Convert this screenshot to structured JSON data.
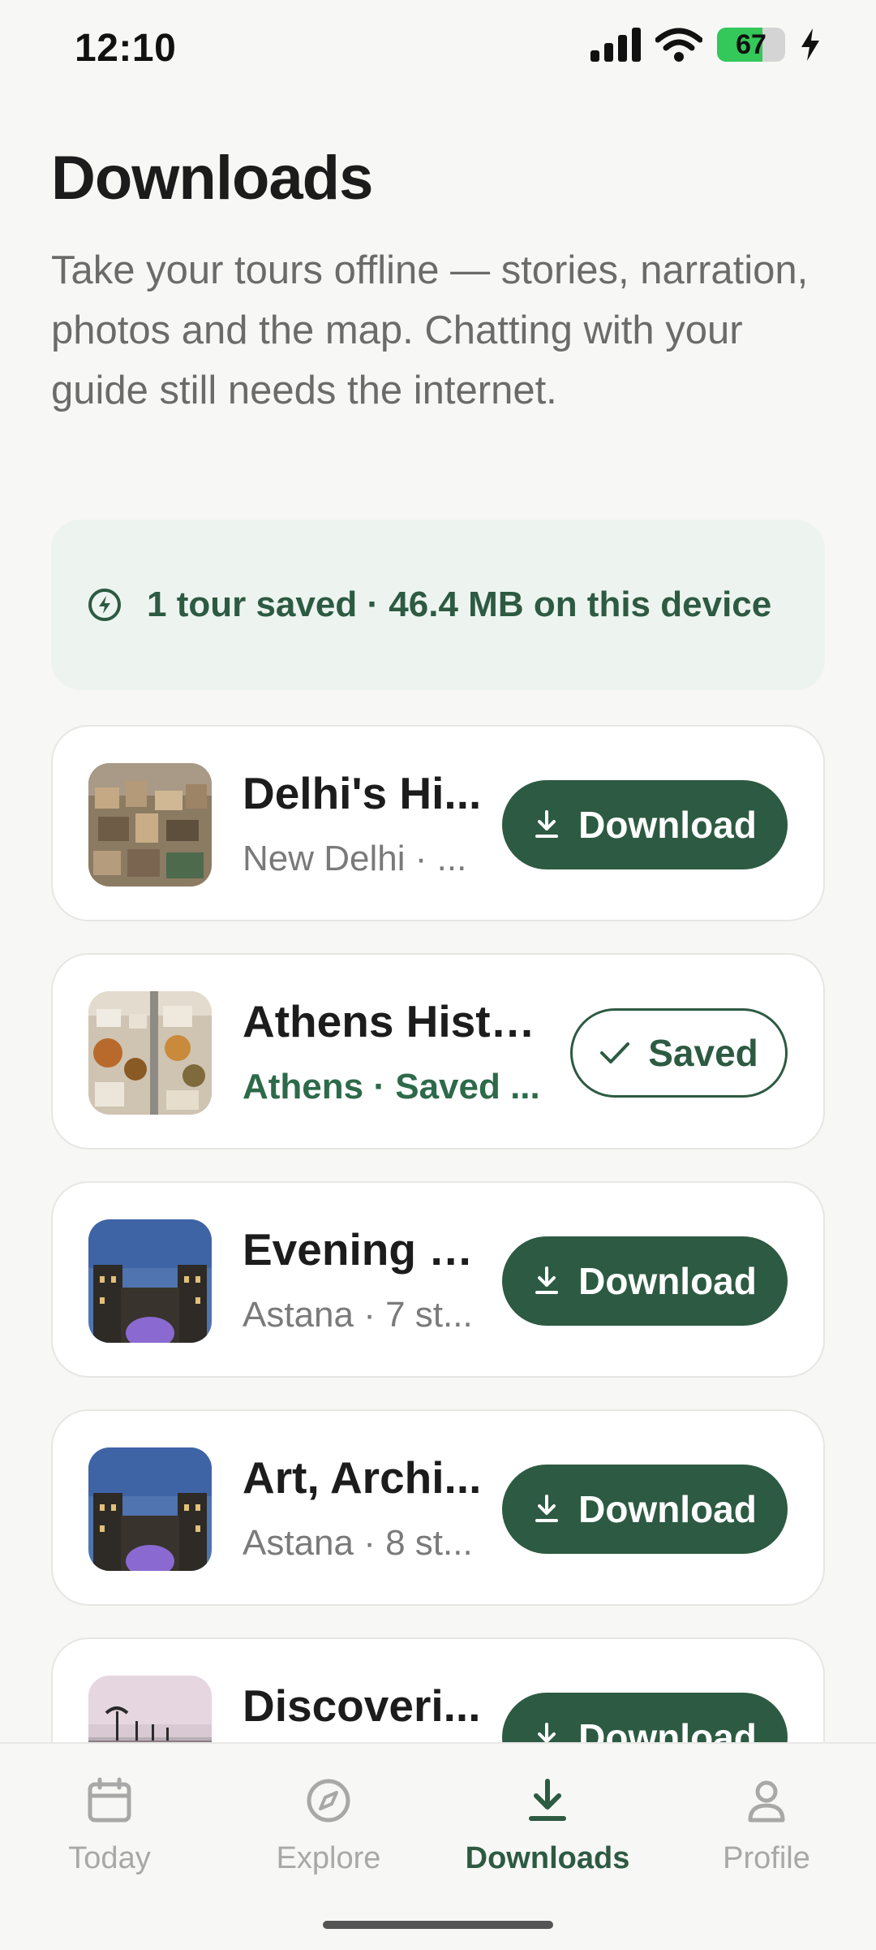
{
  "status_bar": {
    "time": "12:10",
    "battery": "67",
    "battery_level": 0.67
  },
  "header": {
    "title": "Downloads",
    "description": "Take your tours offline — stories, narration, photos and the map. Chatting with your guide still needs the internet."
  },
  "summary": {
    "text": "1 tour saved · 46.4 MB on this device",
    "icon": "bolt-circle-icon"
  },
  "tours": [
    {
      "title": "Delhi's Hi...",
      "subtitle": "New Delhi · ...",
      "status": "download",
      "button_label": "Download",
      "thumb": "delhi"
    },
    {
      "title": "Athens Histo...",
      "subtitle": "Athens · Saved ...",
      "status": "saved",
      "button_label": "Saved",
      "thumb": "athens"
    },
    {
      "title": "Evening E...",
      "subtitle": "Astana · 7 st...",
      "status": "download",
      "button_label": "Download",
      "thumb": "astana"
    },
    {
      "title": "Art, Archi...",
      "subtitle": "Astana · 8 st...",
      "status": "download",
      "button_label": "Download",
      "thumb": "astana"
    },
    {
      "title": "Discoveri...",
      "subtitle": "",
      "status": "download",
      "button_label": "Download",
      "thumb": "beach"
    }
  ],
  "nav": [
    {
      "label": "Today",
      "icon": "calendar-icon",
      "active": false
    },
    {
      "label": "Explore",
      "icon": "compass-icon",
      "active": false
    },
    {
      "label": "Downloads",
      "icon": "download-icon",
      "active": true
    },
    {
      "label": "Profile",
      "icon": "user-icon",
      "active": false
    }
  ],
  "colors": {
    "accent": "#2d5a42",
    "banner_bg": "#edf4ef",
    "saved_text": "#2d6a4a",
    "inactive": "#a8a8a8"
  }
}
